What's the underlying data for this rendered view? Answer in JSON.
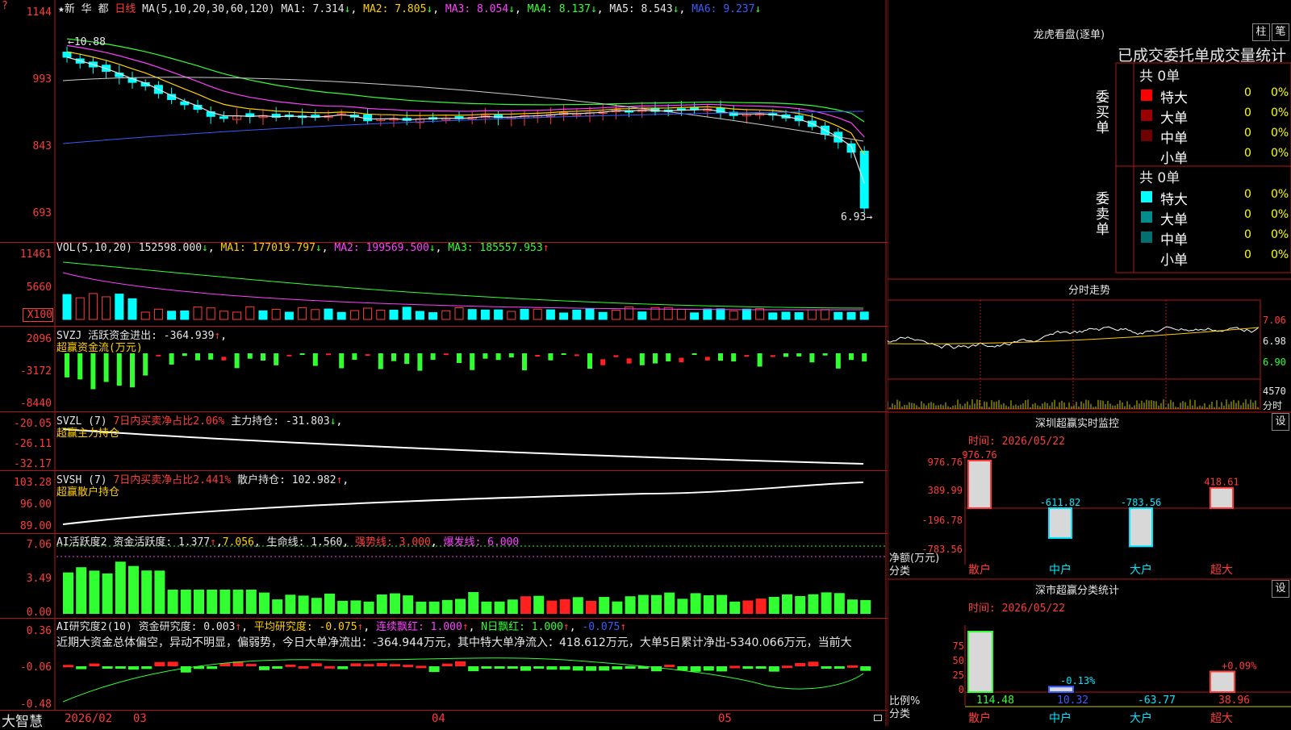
{
  "stock": {
    "name": "新 华 都",
    "period": "日线"
  },
  "price_panel": {
    "ma_title": "MA(5,10,20,30,60,120)",
    "ma1": "MA1: 7.314",
    "ma2": "MA2: 7.805",
    "ma3": "MA3: 8.054",
    "ma4": "MA4: 8.137",
    "ma5": "MA5: 8.543",
    "ma6": "MA6: 9.237",
    "y_labels": [
      "1144",
      "993",
      "843",
      "693"
    ],
    "max_label": "10.88",
    "min_label": "6.93",
    "top_marker": "?"
  },
  "vol_panel": {
    "title": "VOL(5,10,20)",
    "value": "152598.000",
    "ma1": "MA1: 177019.797",
    "ma2": "MA2: 199569.500",
    "ma3": "MA3: 185557.953",
    "y_labels": [
      "11461",
      "5660"
    ],
    "unit": "X100"
  },
  "svzj_panel": {
    "title": "SVZJ",
    "line1": "活跃资金进出: -364.939",
    "line2": "超赢资金流(万元)",
    "y_labels": [
      "2096",
      "-3172",
      "-8440"
    ]
  },
  "svzl_panel": {
    "title": "SVZL (7)",
    "t1": "7日内买卖净占比2.06%",
    "t2": "主力持仓: -31.803",
    "line2": "超赢主力持仓",
    "y_labels": [
      "-20.05",
      "-26.11",
      "-32.17"
    ]
  },
  "svsh_panel": {
    "title": "SVSH (7)",
    "t1": "7日内买卖净占比2.441%",
    "t2": "散户持仓: 102.982",
    "line2": "超赢散户持仓",
    "y_labels": [
      "103.28",
      "96.00",
      "89.00"
    ]
  },
  "ai_active": {
    "title": "AI活跃度2",
    "t1": "资金活跃度: 1.377",
    "t2": "7.056",
    "t3": "生命线: 1.560",
    "t4": "强势线: 3.000",
    "t5": "爆发线: 6.000",
    "y_labels": [
      "7.06",
      "3.49",
      "0.00"
    ]
  },
  "ai_research": {
    "title": "AI研究度2(10)",
    "t1": "资金研究度: 0.003",
    "t2": "平均研究度: -0.075",
    "t3": "连续飘红: 1.000",
    "t4": "N日飘红: 1.000",
    "t5": "-0.075",
    "summary": "近期大资金总体偏空，异动不明显，偏弱势，今日大单净流出：-364.944万元，其中特大单净流入：418.612万元，大单5日累计净出-5340.066万元，当前大",
    "y_labels": [
      "0.36",
      "-0.06",
      "-0.48"
    ]
  },
  "x_axis": {
    "labels": [
      "2026/02",
      "03",
      "04",
      "05"
    ],
    "brand": "大智慧"
  },
  "dragon_tiger": {
    "title": "龙虎看盘(逐单)",
    "btn1": "柱",
    "btn2": "笔",
    "subtitle": "已成交委托单成交量统计",
    "buy_label": "委买单",
    "sell_label": "委卖单",
    "buy_total": "共 0单",
    "sell_total": "共 0单",
    "buy_rows": [
      {
        "name": "特大",
        "v1": "0",
        "v2": "0%",
        "color": "#ff0000"
      },
      {
        "name": "大单",
        "v1": "0",
        "v2": "0%",
        "color": "#9a0000"
      },
      {
        "name": "中单",
        "v1": "0",
        "v2": "0%",
        "color": "#6e0000"
      },
      {
        "name": "小单",
        "v1": "0",
        "v2": "0%",
        "color": "#000000"
      }
    ],
    "sell_rows": [
      {
        "name": "特大",
        "v1": "0",
        "v2": "0%",
        "color": "#00ffff"
      },
      {
        "name": "大单",
        "v1": "0",
        "v2": "0%",
        "color": "#008c8c"
      },
      {
        "name": "中单",
        "v1": "0",
        "v2": "0%",
        "color": "#007070"
      },
      {
        "name": "小单",
        "v1": "0",
        "v2": "0%",
        "color": "#000000"
      }
    ]
  },
  "intraday": {
    "title": "分时走势",
    "y_labels": [
      "7.06",
      "6.98",
      "6.90"
    ],
    "vol_label": "4570",
    "vol_unit": "分时"
  },
  "monitor": {
    "title": "深圳超赢实时监控",
    "btn": "设",
    "time": "时间: 2026/05/22",
    "y_labels": [
      "976.76",
      "389.99",
      "-196.78",
      "-783.56"
    ],
    "ylabel1": "净额(万元)",
    "ylabel2": "分类",
    "chart_data": {
      "type": "bar",
      "categories": [
        "散户",
        "中户",
        "大户",
        "超大"
      ],
      "values": [
        976.76,
        -611.82,
        -783.56,
        418.61
      ],
      "labels": [
        "976.76",
        "-611.82",
        "-783.56",
        "418.61"
      ]
    }
  },
  "classify": {
    "title": "深市超赢分类统计",
    "btn": "设",
    "time": "时间: 2026/05/22",
    "y_labels": [
      "75",
      "50",
      "25",
      "0"
    ],
    "ylabel1": "比例%",
    "ylabel2": "分类",
    "chart_data": {
      "type": "bar",
      "categories": [
        "散户",
        "中户",
        "大户",
        "超大"
      ],
      "values": [
        114.48,
        10.32,
        -63.77,
        38.96
      ],
      "bar_labels": [
        "",
        "-0.13%",
        "",
        "+0.09%"
      ],
      "bottom_labels": [
        "114.48",
        "10.32",
        "-63.77",
        "38.96"
      ]
    }
  }
}
